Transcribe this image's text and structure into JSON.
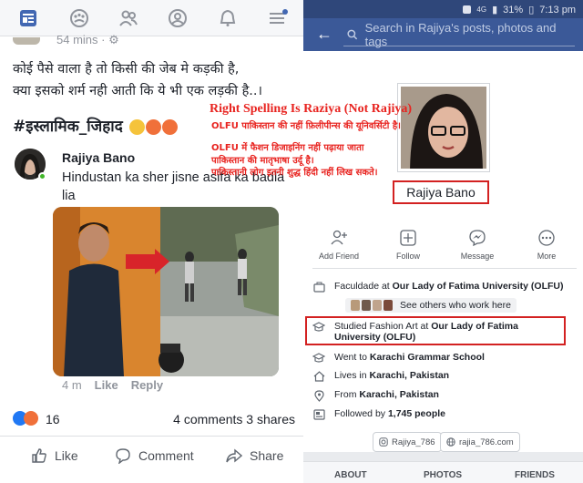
{
  "left_post": {
    "time": "54 mins · ",
    "text_line1": "कोई पैसे वाला है तो किसी की जेब मे कड़की है,",
    "text_line2": "क्या इसको शर्म नही आती कि ये भी एक लड़की है..।",
    "hashtag": "#इस्लामिक_जिहाद",
    "shared_post": {
      "author": "Rajiya Bano",
      "text": "Hindustan ka sher jisne asifa ka badla lia",
      "time": "4 m",
      "like": "Like",
      "reply": "Reply"
    },
    "reaction_count": "16",
    "comments_shares": "4 comments  3 shares",
    "actions": {
      "like": "Like",
      "comment": "Comment",
      "share": "Share"
    }
  },
  "annotations": {
    "title": "Right Spelling Is Raziya (Not Rajiya)",
    "line1": "OLFU पाकिस्तान की नहीं फ़िलीपीन्स की यूनिवर्सिटी है।",
    "line2": "OLFU में फैशन डिजाइनिंग नहीं पढ़ाया जाता",
    "line3": "पाकिस्तान की मातृभाषा उर्दू है।",
    "line4": "पाकिस्तानी लोग इतनी शुद्ध हिंदी नहीं लिख सकते।"
  },
  "right_profile": {
    "status": {
      "battery": "31%",
      "time": "7:13 pm",
      "network": "4G"
    },
    "search_placeholder": "Search in Rajiya's posts, photos and tags",
    "name": "Rajiya Bano",
    "actions": [
      "Add Friend",
      "Follow",
      "Message",
      "More"
    ],
    "faculty_prefix": "Faculdade at ",
    "faculty_place": "Our Lady of Fatima University (OLFU)",
    "coworkers": "See others who work here",
    "studied_prefix": "Studied Fashion Art at ",
    "studied_place": "Our Lady of Fatima University (OLFU)",
    "went_prefix": "Went to ",
    "went_place": "Karachi Grammar School",
    "lives_prefix": "Lives in ",
    "lives_place": "Karachi, Pakistan",
    "from_prefix": "From ",
    "from_place": "Karachi, Pakistan",
    "followed_prefix": "Followed by ",
    "followed_count": "1,745 people",
    "instagram": "Rajiya_786",
    "website": "rajia_786.com",
    "tabs": [
      "ABOUT",
      "PHOTOS",
      "FRIENDS"
    ]
  },
  "colors": {
    "facebook_blue": "#3b5998",
    "annotation_red": "#e8231f",
    "highlight_box_red": "#d32121"
  }
}
